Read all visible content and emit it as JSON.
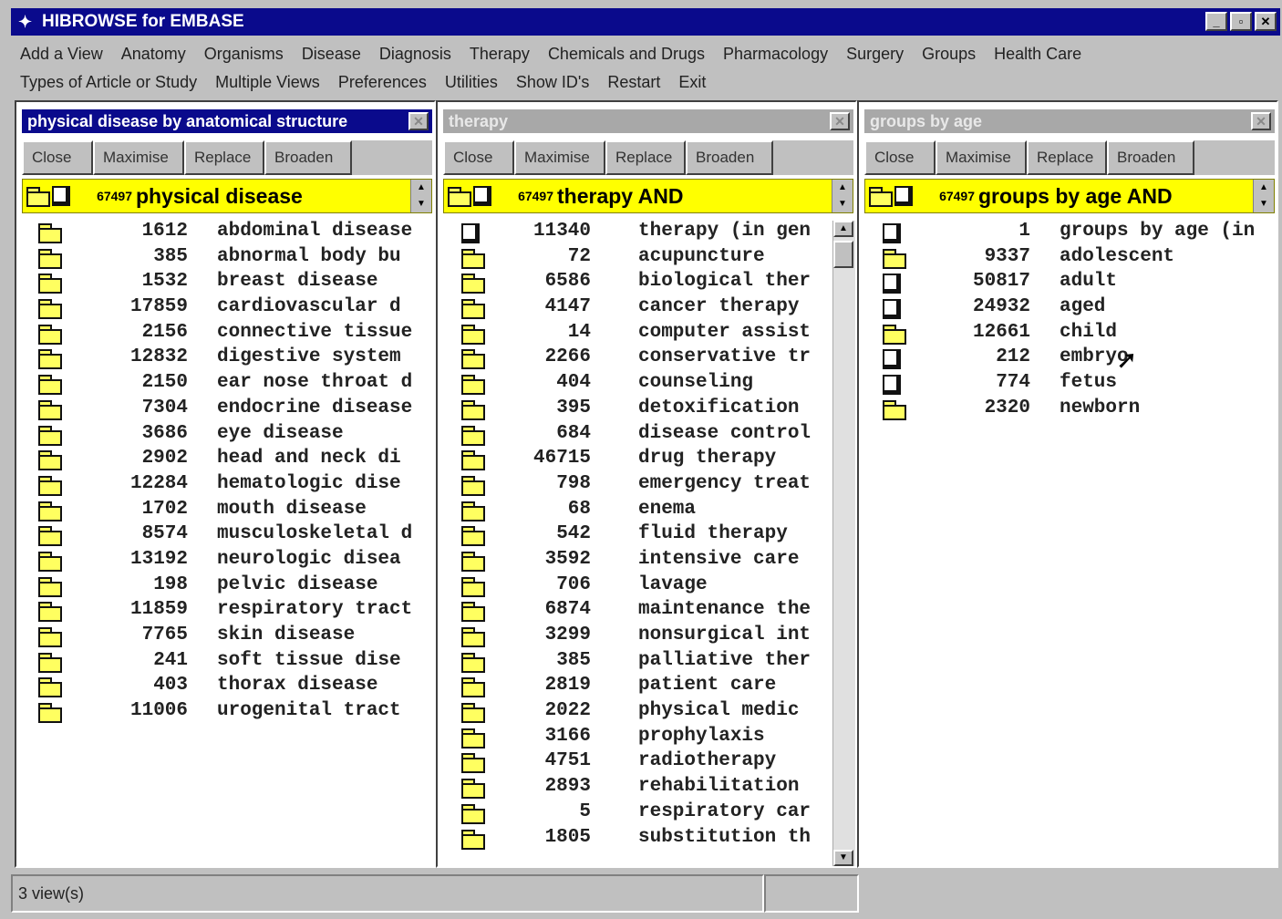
{
  "app": {
    "title": "HIBROWSE for EMBASE"
  },
  "menus": {
    "row1": [
      "Add a View",
      "Anatomy",
      "Organisms",
      "Disease",
      "Diagnosis",
      "Therapy",
      "Chemicals and Drugs",
      "Pharmacology",
      "Surgery",
      "Groups",
      "Health Care"
    ],
    "row2": [
      "Types of Article or Study",
      "Multiple Views",
      "Preferences",
      "Utilities",
      "Show ID's",
      "Restart",
      "Exit"
    ]
  },
  "toolbar_labels": {
    "close": "Close",
    "maximise": "Maximise",
    "replace": "Replace",
    "broaden": "Broaden"
  },
  "panes": [
    {
      "title": "physical disease by anatomical structure",
      "header": {
        "count": "67497",
        "label": "physical disease"
      },
      "rows": [
        {
          "icon": "folder",
          "count": "1612",
          "label": "abdominal disease"
        },
        {
          "icon": "folder",
          "count": "385",
          "label": "abnormal body bu"
        },
        {
          "icon": "folder",
          "count": "1532",
          "label": "breast disease"
        },
        {
          "icon": "folder",
          "count": "17859",
          "label": "cardiovascular d"
        },
        {
          "icon": "folder",
          "count": "2156",
          "label": "connective tissue"
        },
        {
          "icon": "folder",
          "count": "12832",
          "label": "digestive system"
        },
        {
          "icon": "folder",
          "count": "2150",
          "label": "ear nose throat d"
        },
        {
          "icon": "folder",
          "count": "7304",
          "label": "endocrine disease"
        },
        {
          "icon": "folder",
          "count": "3686",
          "label": "eye disease"
        },
        {
          "icon": "folder",
          "count": "2902",
          "label": "head and neck di"
        },
        {
          "icon": "folder",
          "count": "12284",
          "label": "hematologic dise"
        },
        {
          "icon": "folder",
          "count": "1702",
          "label": "mouth disease"
        },
        {
          "icon": "folder",
          "count": "8574",
          "label": "musculoskeletal d"
        },
        {
          "icon": "folder",
          "count": "13192",
          "label": "neurologic disea"
        },
        {
          "icon": "folder",
          "count": "198",
          "label": "pelvic disease"
        },
        {
          "icon": "folder",
          "count": "11859",
          "label": "respiratory tract"
        },
        {
          "icon": "folder",
          "count": "7765",
          "label": "skin disease"
        },
        {
          "icon": "folder",
          "count": "241",
          "label": "soft tissue dise"
        },
        {
          "icon": "folder",
          "count": "403",
          "label": "thorax disease"
        },
        {
          "icon": "folder",
          "count": "11006",
          "label": "urogenital tract"
        }
      ]
    },
    {
      "title": "therapy",
      "header": {
        "count": "67497",
        "label": "therapy AND"
      },
      "rows": [
        {
          "icon": "doc",
          "count": "11340",
          "label": "therapy (in gen"
        },
        {
          "icon": "folder",
          "count": "72",
          "label": "acupuncture"
        },
        {
          "icon": "folder",
          "count": "6586",
          "label": "biological ther"
        },
        {
          "icon": "folder",
          "count": "4147",
          "label": "cancer therapy"
        },
        {
          "icon": "folder",
          "count": "14",
          "label": "computer assist"
        },
        {
          "icon": "folder",
          "count": "2266",
          "label": "conservative tr"
        },
        {
          "icon": "folder",
          "count": "404",
          "label": "counseling"
        },
        {
          "icon": "folder",
          "count": "395",
          "label": "detoxification"
        },
        {
          "icon": "folder",
          "count": "684",
          "label": "disease control"
        },
        {
          "icon": "folder",
          "count": "46715",
          "label": "drug therapy"
        },
        {
          "icon": "folder",
          "count": "798",
          "label": "emergency treat"
        },
        {
          "icon": "folder",
          "count": "68",
          "label": "enema"
        },
        {
          "icon": "folder",
          "count": "542",
          "label": "fluid therapy"
        },
        {
          "icon": "folder",
          "count": "3592",
          "label": "intensive care"
        },
        {
          "icon": "folder",
          "count": "706",
          "label": "lavage"
        },
        {
          "icon": "folder",
          "count": "6874",
          "label": "maintenance the"
        },
        {
          "icon": "folder",
          "count": "3299",
          "label": "nonsurgical int"
        },
        {
          "icon": "folder",
          "count": "385",
          "label": "palliative ther"
        },
        {
          "icon": "folder",
          "count": "2819",
          "label": "patient care"
        },
        {
          "icon": "folder",
          "count": "2022",
          "label": "physical medic"
        },
        {
          "icon": "folder",
          "count": "3166",
          "label": "prophylaxis"
        },
        {
          "icon": "folder",
          "count": "4751",
          "label": "radiotherapy"
        },
        {
          "icon": "folder",
          "count": "2893",
          "label": "rehabilitation"
        },
        {
          "icon": "folder",
          "count": "5",
          "label": "respiratory car"
        },
        {
          "icon": "folder",
          "count": "1805",
          "label": "substitution th"
        }
      ]
    },
    {
      "title": "groups by age",
      "header": {
        "count": "67497",
        "label": "groups by age AND"
      },
      "rows": [
        {
          "icon": "doc",
          "count": "1",
          "label": "groups by age (in"
        },
        {
          "icon": "folder",
          "count": "9337",
          "label": "adolescent"
        },
        {
          "icon": "doc",
          "count": "50817",
          "label": "adult"
        },
        {
          "icon": "doc",
          "count": "24932",
          "label": "aged"
        },
        {
          "icon": "folder",
          "count": "12661",
          "label": "child"
        },
        {
          "icon": "doc",
          "count": "212",
          "label": "embryo"
        },
        {
          "icon": "doc",
          "count": "774",
          "label": "fetus"
        },
        {
          "icon": "folder",
          "count": "2320",
          "label": "newborn"
        }
      ]
    }
  ],
  "status": {
    "views": "3 view(s)"
  }
}
